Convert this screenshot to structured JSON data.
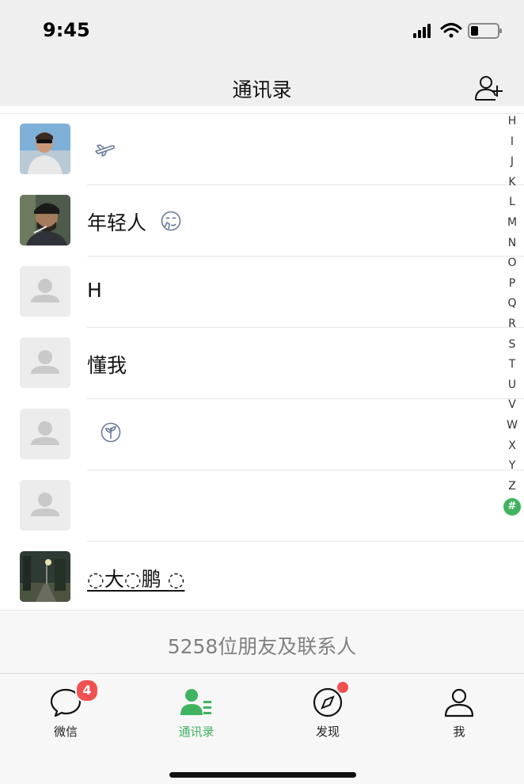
{
  "status_bar": {
    "time": "9:45"
  },
  "nav": {
    "title": "通讯录",
    "add_icon": "add-contact-icon"
  },
  "contacts": [
    {
      "name": "",
      "emoji": "airplane-icon",
      "avatar": "photo-man-sunglasses"
    },
    {
      "name": "年轻人",
      "emoji": "face-emoji-icon",
      "avatar": "photo-man-smoking"
    },
    {
      "name": "H",
      "emoji": "",
      "avatar": "default-avatar"
    },
    {
      "name": "懂我",
      "emoji": "",
      "avatar": "default-avatar"
    },
    {
      "name": "",
      "emoji": "sprout-icon",
      "avatar": "default-avatar"
    },
    {
      "name": "",
      "emoji": "",
      "avatar": "default-avatar"
    },
    {
      "name": "◌大◌鹏 ◌",
      "emoji": "",
      "avatar": "photo-night-street"
    }
  ],
  "index_letters": [
    "H",
    "I",
    "J",
    "K",
    "L",
    "M",
    "N",
    "O",
    "P",
    "Q",
    "R",
    "S",
    "T",
    "U",
    "V",
    "W",
    "X",
    "Y",
    "Z"
  ],
  "index_hash": "#",
  "footer": {
    "count_text": "5258位朋友及联系人"
  },
  "tabs": [
    {
      "label": "微信",
      "icon": "chat-bubble-icon",
      "badge": "4",
      "active": false
    },
    {
      "label": "通讯录",
      "icon": "contacts-icon",
      "badge": "",
      "active": true
    },
    {
      "label": "发现",
      "icon": "compass-icon",
      "badge": "dot",
      "active": false
    },
    {
      "label": "我",
      "icon": "person-icon",
      "badge": "",
      "active": false
    }
  ],
  "colors": {
    "accent": "#3fb35f",
    "badge": "#f25151",
    "nav_bg": "#efefef"
  }
}
